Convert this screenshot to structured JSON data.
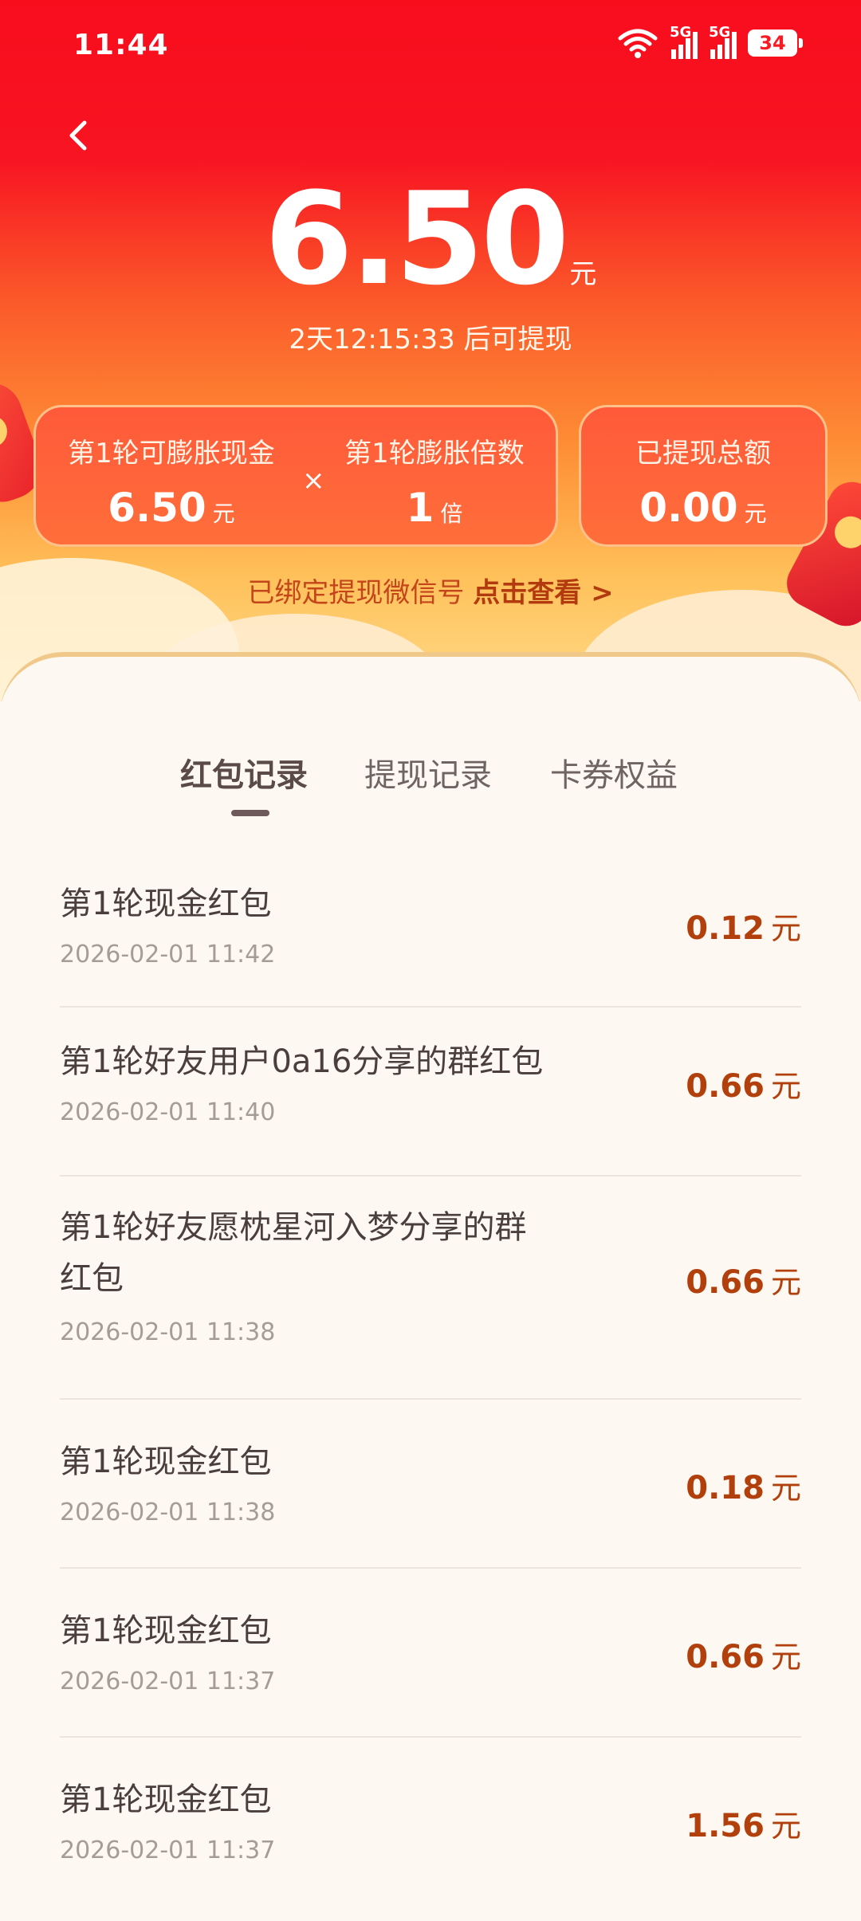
{
  "status_bar": {
    "time": "11:44",
    "battery": "34",
    "network_1": "5G",
    "network_2": "5G"
  },
  "summary": {
    "amount": "6.50",
    "unit": "元",
    "countdown": "2天12:15:33 后可提现"
  },
  "cards": {
    "expandable_label": "第1轮可膨胀现金",
    "expandable_value": "6.50",
    "expandable_unit": "元",
    "multiply_symbol": "×",
    "multiplier_label": "第1轮膨胀倍数",
    "multiplier_value": "1",
    "multiplier_unit": "倍",
    "withdrawn_label": "已提现总额",
    "withdrawn_value": "0.00",
    "withdrawn_unit": "元"
  },
  "wechat_bind": {
    "text": "已绑定提现微信号",
    "link": "点击查看 >"
  },
  "tabs": [
    {
      "label": "红包记录",
      "active": true
    },
    {
      "label": "提现记录",
      "active": false
    },
    {
      "label": "卡券权益",
      "active": false
    }
  ],
  "records": [
    {
      "title": "第1轮现金红包",
      "time": "2026-02-01 11:42",
      "amount": "0.12",
      "unit": "元"
    },
    {
      "title": "第1轮好友用户0a16分享的群红包",
      "time": "2026-02-01 11:40",
      "amount": "0.66",
      "unit": "元"
    },
    {
      "title": "第1轮好友愿枕星河入梦分享的群红包",
      "time": "2026-02-01 11:38",
      "amount": "0.66",
      "unit": "元"
    },
    {
      "title": "第1轮现金红包",
      "time": "2026-02-01 11:38",
      "amount": "0.18",
      "unit": "元"
    },
    {
      "title": "第1轮现金红包",
      "time": "2026-02-01 11:37",
      "amount": "0.66",
      "unit": "元"
    },
    {
      "title": "第1轮现金红包",
      "time": "2026-02-01 11:37",
      "amount": "1.56",
      "unit": "元"
    }
  ]
}
